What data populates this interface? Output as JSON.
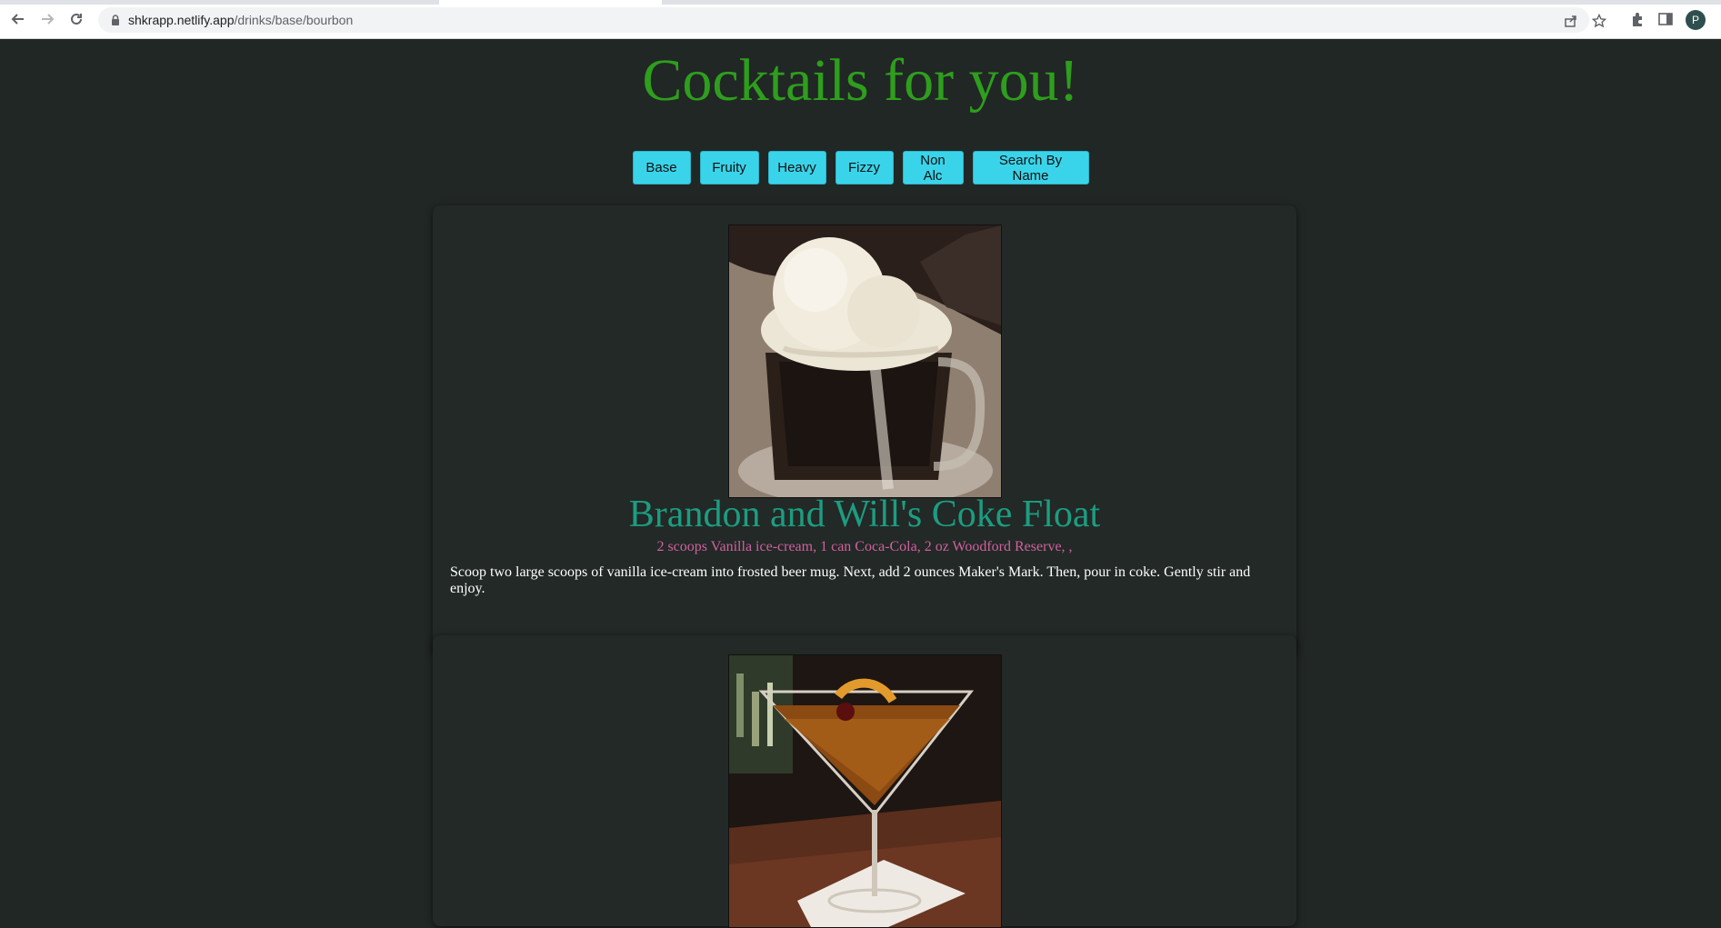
{
  "browser": {
    "url_host": "shkrapp.netlify.app",
    "url_path": "/drinks/base/bourbon",
    "avatar_letter": "P"
  },
  "site": {
    "title": "Cocktails for you!"
  },
  "nav": {
    "base": "Base",
    "fruity": "Fruity",
    "heavy": "Heavy",
    "fizzy": "Fizzy",
    "non_alc": "Non Alc",
    "search": "Search By Name"
  },
  "drinks": [
    {
      "name": "Brandon and Will's Coke Float",
      "ingredients": "2 scoops Vanilla ice-cream, 1 can Coca-Cola, 2 oz Woodford Reserve, ,",
      "instructions": "Scoop two large scoops of vanilla ice-cream into frosted beer mug. Next, add 2 ounces Maker's Mark. Then, pour in coke. Gently stir and enjoy."
    },
    {
      "name": "",
      "ingredients": "",
      "instructions": ""
    }
  ],
  "colors": {
    "page_bg": "#212725",
    "title": "#2e9e1d",
    "button": "#3ad4ea",
    "drink_name": "#1d9c80",
    "ingredients": "#d45fa0"
  }
}
